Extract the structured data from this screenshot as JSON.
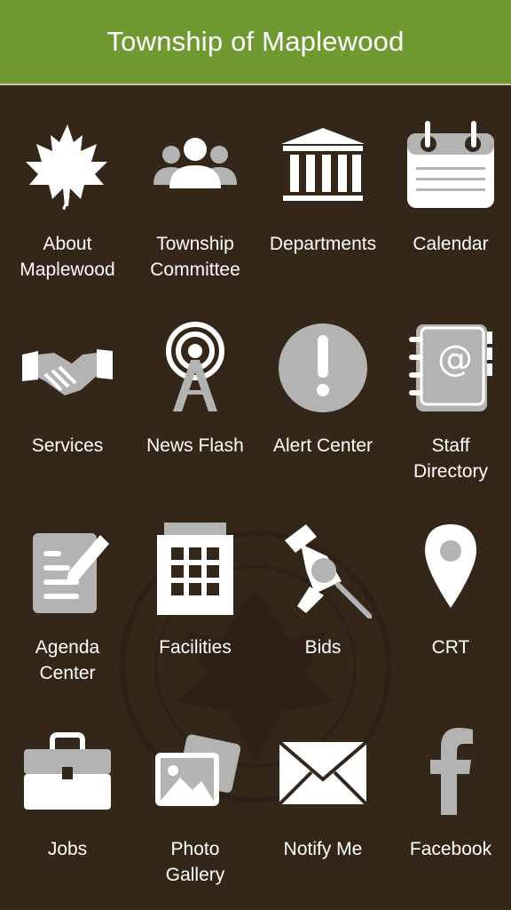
{
  "header": {
    "title": "Township of Maplewood"
  },
  "colors": {
    "header_bg": "#6e9a31",
    "body_bg": "#35261a",
    "icon": "#ffffff",
    "icon_gray": "#b3b3b3"
  },
  "tiles": [
    {
      "icon": "maple-leaf-icon",
      "line1": "About",
      "line2": "Maplewood"
    },
    {
      "icon": "people-icon",
      "line1": "Township",
      "line2": "Committee"
    },
    {
      "icon": "building-icon",
      "line1": "Departments",
      "line2": ""
    },
    {
      "icon": "calendar-icon",
      "line1": "Calendar",
      "line2": ""
    },
    {
      "icon": "handshake-icon",
      "line1": "Services",
      "line2": ""
    },
    {
      "icon": "broadcast-tower-icon",
      "line1": "News Flash",
      "line2": ""
    },
    {
      "icon": "alert-icon",
      "line1": "Alert Center",
      "line2": ""
    },
    {
      "icon": "address-book-icon",
      "line1": "Staff",
      "line2": "Directory"
    },
    {
      "icon": "document-edit-icon",
      "line1": "Agenda",
      "line2": "Center"
    },
    {
      "icon": "facilities-grid-icon",
      "line1": "Facilities",
      "line2": ""
    },
    {
      "icon": "pushpin-icon",
      "line1": "Bids",
      "line2": ""
    },
    {
      "icon": "map-pin-icon",
      "line1": "CRT",
      "line2": ""
    },
    {
      "icon": "briefcase-icon",
      "line1": "Jobs",
      "line2": ""
    },
    {
      "icon": "photo-gallery-icon",
      "line1": "Photo",
      "line2": "Gallery"
    },
    {
      "icon": "envelope-icon",
      "line1": "Notify Me",
      "line2": ""
    },
    {
      "icon": "facebook-icon",
      "line1": "Facebook",
      "line2": ""
    }
  ]
}
